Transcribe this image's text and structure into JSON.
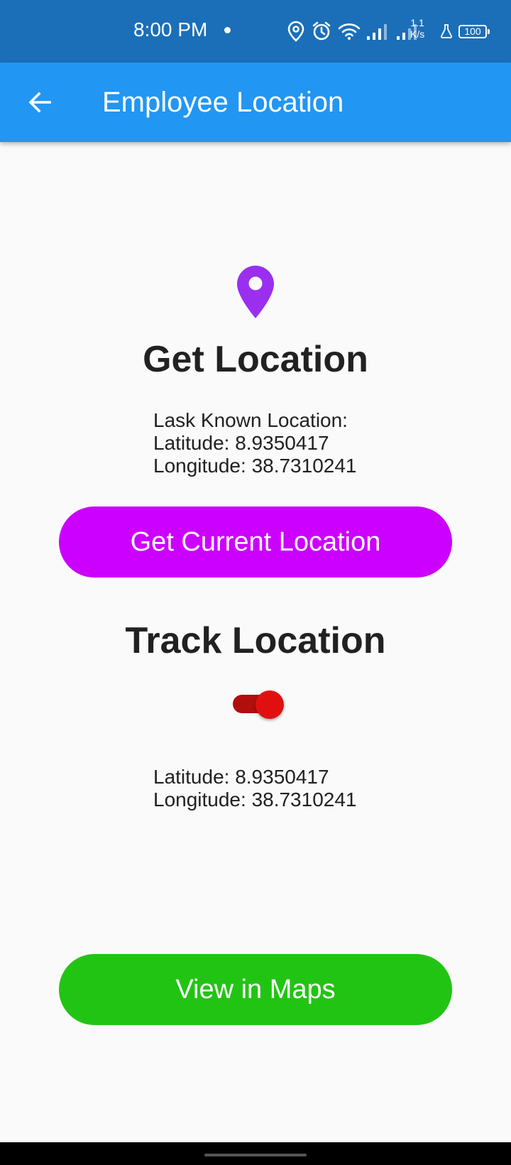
{
  "status_bar": {
    "time": "8:00 PM",
    "speed_value": "1.1",
    "speed_unit": "K/s",
    "battery": "100"
  },
  "app_bar": {
    "title": "Employee Location",
    "back_icon": "arrow-left-icon"
  },
  "get_location": {
    "icon": "location-pin-icon",
    "heading": "Get Location",
    "last_known_label": "Lask Known Location:",
    "latitude": "Latitude: 8.9350417",
    "longitude": "Longitude: 38.7310241",
    "button_label": "Get Current Location"
  },
  "track_location": {
    "heading": "Track Location",
    "toggle_on": true,
    "latitude": "Latitude: 8.9350417",
    "longitude": "Longitude: 38.7310241"
  },
  "maps_button_label": "View in Maps",
  "colors": {
    "status_bar": "#1b6fb8",
    "app_bar": "#2196f3",
    "pin": "#9b2ff0",
    "current_button": "#cc00ff",
    "maps_button": "#22c414",
    "toggle": "#e01010"
  }
}
